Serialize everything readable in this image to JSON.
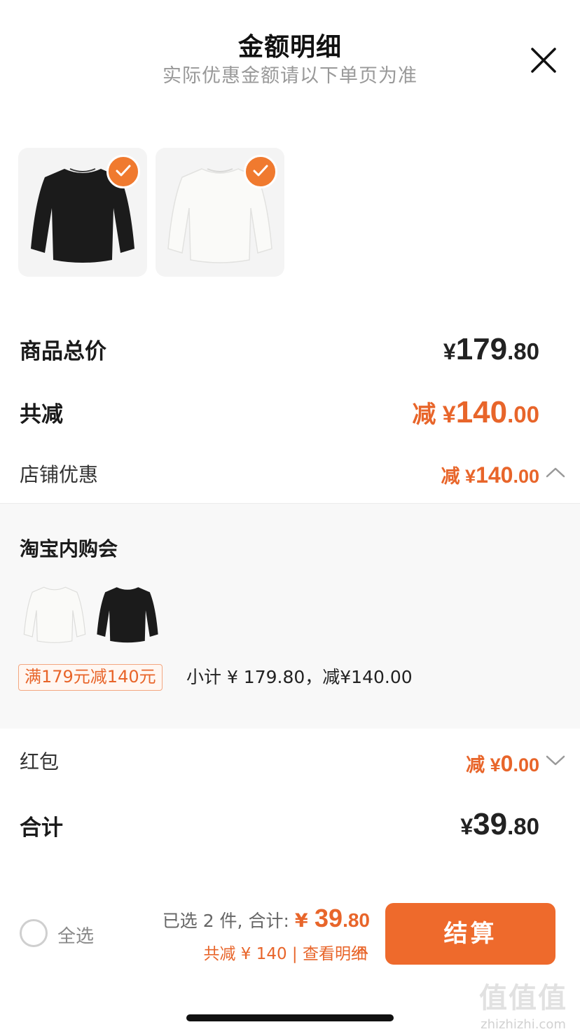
{
  "header": {
    "title": "金额明细",
    "subtitle": "实际优惠金额请以下单页为准"
  },
  "products": [
    {
      "name": "black-longsleeve",
      "color": "#1b1b1b",
      "checked": true
    },
    {
      "name": "white-longsleeve",
      "color": "#f2f2f0",
      "checked": true
    }
  ],
  "rows": {
    "total_label": "商品总价",
    "total_currency": "¥",
    "total_int": "179",
    "total_dec": ".80",
    "discount_label": "共减",
    "discount_prefix": "减 ¥",
    "discount_int": "140",
    "discount_dec": ".00",
    "shop_label": "店铺优惠",
    "shop_prefix": "减 ¥",
    "shop_int": "140",
    "shop_dec": ".00"
  },
  "promo": {
    "title": "淘宝内购会",
    "tag": "满179元减140元",
    "subtotal": "小计 ¥ 179.80，减¥140.00"
  },
  "redpacket": {
    "label": "红包",
    "prefix": "减 ¥",
    "int": "0",
    "dec": ".00"
  },
  "sum": {
    "label": "合计",
    "currency": "¥",
    "int": "39",
    "dec": ".80"
  },
  "footer": {
    "select_all": "全选",
    "selected_text": "已选 2 件, 合计: ",
    "selected_currency": "¥ ",
    "selected_int": "39",
    "selected_dec": ".80",
    "savings_text": "共减 ¥ 140 | 查看明细",
    "checkout": "结算"
  },
  "watermark": {
    "site": "zhizhizhi.com",
    "mark": "值值值"
  },
  "colors": {
    "accent": "#e8652a",
    "button": "#ee6a2c",
    "panel": "#f8f8f8"
  }
}
